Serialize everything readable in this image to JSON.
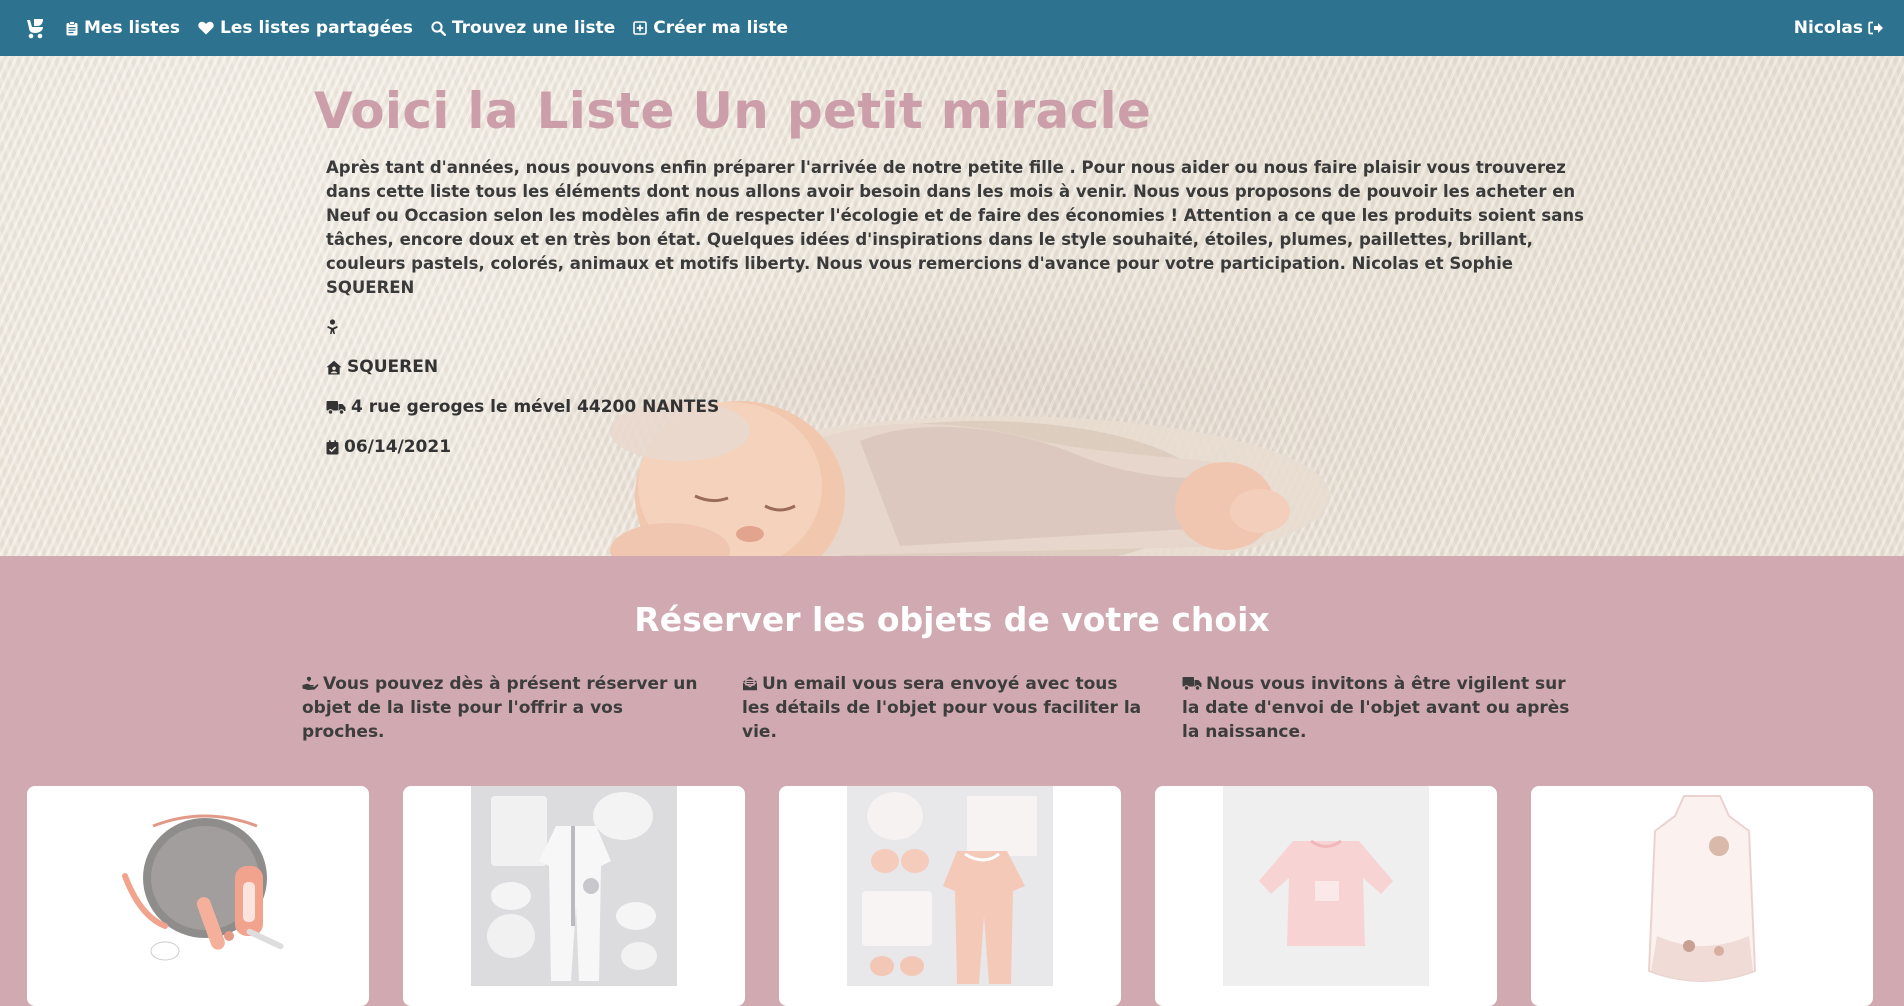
{
  "nav": {
    "brand_icon": "baby-carriage-icon",
    "items": [
      {
        "label": "Mes listes",
        "icon": "clipboard-icon"
      },
      {
        "label": "Les listes partagées",
        "icon": "heart-icon"
      },
      {
        "label": "Trouvez une liste",
        "icon": "search-icon"
      },
      {
        "label": "Créer ma liste",
        "icon": "plus-square-icon"
      }
    ],
    "user": {
      "label": "Nicolas",
      "icon": "sign-out-icon"
    },
    "color": "#2d7390"
  },
  "hero": {
    "title": "Voici la Liste Un petit miracle",
    "title_color": "#cc9ea9",
    "description": "Après tant d'années, nous pouvons enfin préparer l'arrivée de notre petite fille . Pour nous aider ou nous faire plaisir vous trouverez dans cette liste tous les éléments dont nous allons avoir besoin dans les mois à venir. Nous vous proposons de pouvoir les acheter en Neuf ou Occasion selon les modèles afin de respecter l'écologie et de faire des économies ! Attention a ce que les produits soient sans tâches, encore doux et en très bon état. Quelques idées d'inspirations dans le style souhaité, étoiles, plumes, paillettes, brillant, couleurs pastels, colorés, animaux et motifs liberty. Nous vous remercions d'avance pour votre participation. Nicolas et Sophie SQUEREN",
    "gender_icon": "baby-icon",
    "family_name": "SQUEREN",
    "address": "4 rue geroges le mével 44200 NANTES",
    "date": "06/14/2021"
  },
  "section": {
    "title": "Réserver les objets de votre choix",
    "background": "#d0a9b1",
    "features": [
      {
        "icon": "hand-holding-heart-icon",
        "text": "Vous pouvez dès à présent réserver un objet de la liste pour l'offrir a vos proches."
      },
      {
        "icon": "envelope-open-icon",
        "text": "Un email vous sera envoyé avec tous les détails de l'objet pour vous faciliter la vie."
      },
      {
        "icon": "truck-icon",
        "text": "Nous vous invitons à être vigilent sur la date d'envoi de l'objet avant ou après la naissance."
      }
    ]
  },
  "products": [
    {
      "image": "baby-care-kit"
    },
    {
      "image": "white-pajama-set"
    },
    {
      "image": "pink-pajama-set"
    },
    {
      "image": "pink-sweater"
    },
    {
      "image": "sleeping-bag"
    }
  ]
}
